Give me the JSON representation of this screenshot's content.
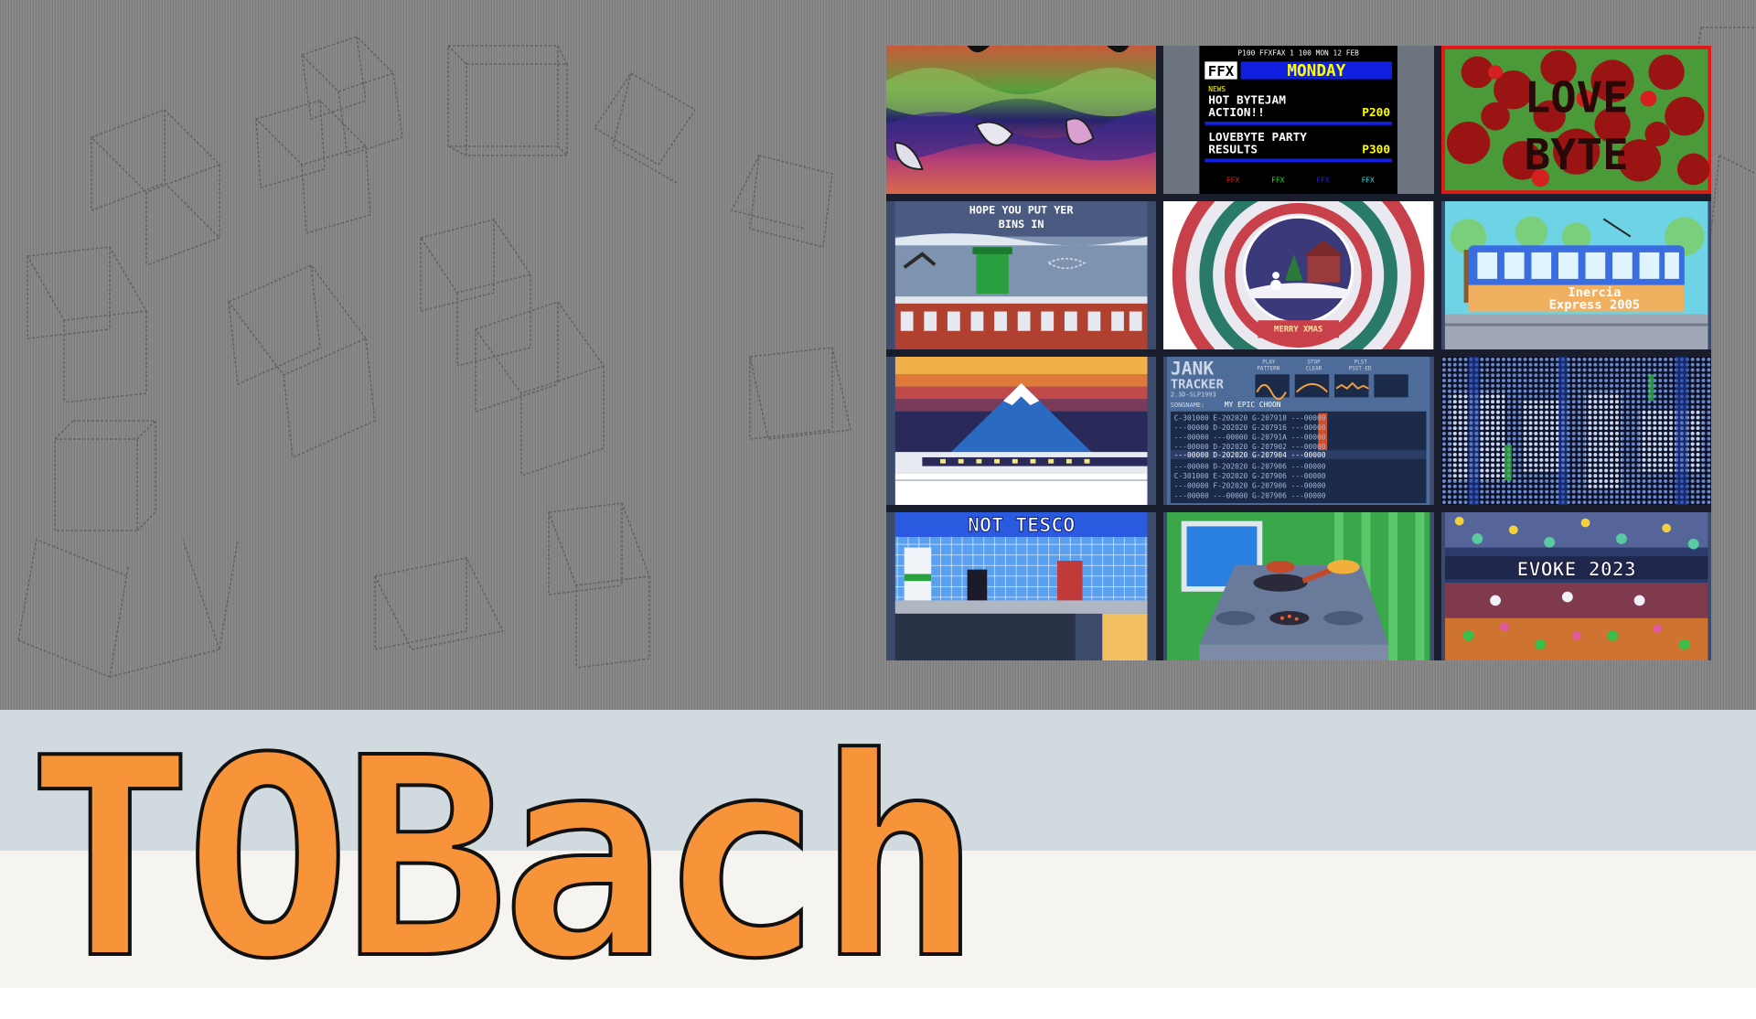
{
  "title": "TOBach",
  "colors": {
    "title": "#f7943a",
    "title_outline": "#111111",
    "band_blue": "#d0dadf",
    "band_cream": "#f5f4f0",
    "background": "#858585",
    "grid_border": "#1a1e2c"
  },
  "thumbs": {
    "teletext": {
      "header": "P100 FFXFAX 1 100 MON 12 FEB",
      "brand": "FFX",
      "day": "MONDAY",
      "section": "NEWS",
      "story1_l1": "HOT BYTEJAM",
      "story1_l2": "ACTION!!",
      "story1_page": "P200",
      "story2_l1": "LOVEBYTE PARTY",
      "story2_l2": "RESULTS",
      "story2_page": "P300",
      "footer": [
        "FFX",
        "FFX",
        "FFX",
        "FFX"
      ]
    },
    "lovebyte": {
      "l1": "LOVE",
      "l2": "BYTE"
    },
    "bins": {
      "l1": "HOPE YOU PUT YER",
      "l2": "BINS IN"
    },
    "snowglobe": {
      "caption": "MERRY XMAS"
    },
    "tram": {
      "l1": "Inercia",
      "l2": "Express 2005"
    },
    "tracker": {
      "t1": "JANK",
      "t2": "TRACKER",
      "version": "2.3D-SLP1993",
      "btn_play": "PLAY",
      "btn_pattern": "PATTERN",
      "btn_stop": "STOP",
      "btn_clear": "CLEAR",
      "btn_plst": "PLST",
      "btn_psst": "PSST-ED",
      "songname_label": "SONGNAME:",
      "songname": "MY EPIC CHOON",
      "rows": [
        "C-301000 E-202020 G-207918 ---00000",
        "---00000 D-202020 G-207916 ---00000",
        "---00000 ---00000 G-20791A ---00000",
        "---00000 D-202020 G-207902 ---00000",
        "---00000 D-202020 G-207904 ---00000",
        "---00000 D-202020 G-207906 ---00000",
        "C-301000 E-202020 G-207906 ---00000",
        "---00000 F-202020 G-207906 ---00000",
        "---00000 ---00000 G-207906 ---00000"
      ]
    },
    "shop": {
      "label": "NOT TESCO"
    },
    "evoke": {
      "label": "EVOKE 2023"
    }
  }
}
